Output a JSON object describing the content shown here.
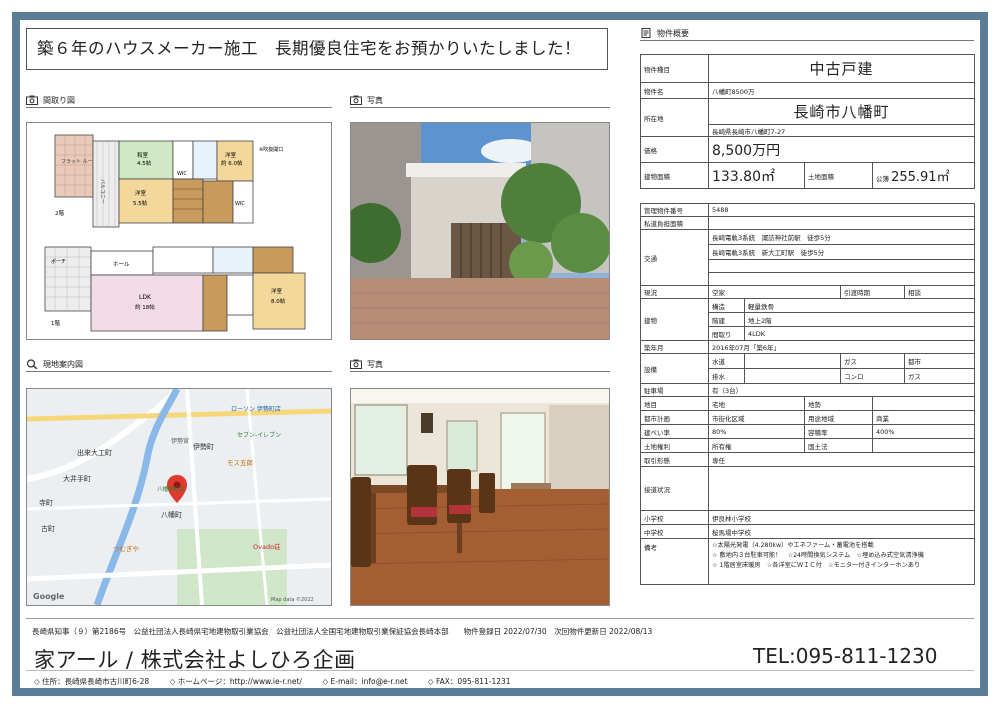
{
  "headline": "築６年のハウスメーカー施工　長期優良住宅をお預かりいたしました！",
  "sections": {
    "floorplan": "間取り図",
    "photo1": "写真",
    "map": "現地案内図",
    "photo2": "写真",
    "overview": "物件概要"
  },
  "floorplan_labels": {
    "balcony": "バルコニー",
    "floor2": "2階",
    "floor1": "1階",
    "ldk": "LDK",
    "ldk_size": "約 18帖",
    "room1": "洋室",
    "room1_size": "5.5帖",
    "room2": "洋室",
    "room2_size": "約 6.0帖",
    "room3": "洋室",
    "room3_size": "8.0帖",
    "washitsu": "和室",
    "washitsu_size": "4.5帖",
    "wic1": "WIC",
    "wic2": "WIC",
    "hall": "ホール",
    "porch": "ポーチ",
    "note": "※吹抜開口",
    "roof": "フラット ルーフ"
  },
  "map_labels": {
    "yahata": "八幡町",
    "ise": "伊勢町",
    "ise_shrine": "伊勢宮",
    "idekuwa": "出来大工町",
    "oisawa": "大井手町",
    "tera": "寺町",
    "furu": "古町",
    "lawson": "ローソン 伊勢町店",
    "seven": "セブン-イレブン",
    "mos": "モス五郎",
    "ovado": "Ovado荘",
    "tsumugiya": "つむぎや",
    "google": "Google",
    "mapdata": "Map data ©2022",
    "shrine": "八幡神社前"
  },
  "table1": {
    "kind_label": "物件種目",
    "kind_value": "中古戸建",
    "name_label": "物件名",
    "name_value": "八幡町8500万",
    "loc_label": "所在地",
    "loc_value_big": "長崎市八幡町",
    "loc_value_small": "長崎県長崎市八幡町7-27",
    "price_label": "価格",
    "price_value": "8,500万円",
    "bldg_area_label": "建物面積",
    "bldg_area_value": "133.80㎡",
    "land_area_label": "土地面積",
    "land_area_prefix": "公簿",
    "land_area_value": "255.91㎡"
  },
  "table2": {
    "mgmt_no_label": "管理物件番号",
    "mgmt_no_value": "5488",
    "private_road_label": "私道負担面積",
    "private_road_value": "",
    "traffic_label": "交通",
    "traffic_1": "長崎電軌3系統　諏訪神社前駅　徒歩5分",
    "traffic_2": "長崎電軌3系統　新大工町駅　徒歩5分",
    "status_label": "現況",
    "status_value": "空家",
    "handover_label": "引渡時期",
    "handover_value": "相談",
    "building_label": "建物",
    "structure_label": "構造",
    "structure_value": "軽量鉄骨",
    "floors_label": "階建",
    "floors_value": "地上2階",
    "layout_label": "間取り",
    "layout_value": "4LDK",
    "built_label": "築年月",
    "built_value": "2016年07月「築6年」",
    "facility_label": "設備",
    "water_label": "水道",
    "water_value": "",
    "gas_label": "ガス",
    "gas_value": "都市",
    "drain_label": "排水",
    "drain_value": "",
    "stove_label": "コンロ",
    "stove_value": "ガス",
    "parking_label": "駐車場",
    "parking_value": "有（3台）",
    "land_cat_label": "地目",
    "land_cat_value": "宅地",
    "terrain_label": "地勢",
    "terrain_value": "",
    "city_plan_label": "都市計画",
    "city_plan_value": "市街化区域",
    "use_zone_label": "用途地域",
    "use_zone_value": "商業",
    "coverage_label": "建ぺい率",
    "coverage_value": "80%",
    "far_label": "容積率",
    "far_value": "400%",
    "land_right_label": "土地権利",
    "land_right_value": "所有権",
    "land_law_label": "国土法",
    "land_law_value": "",
    "trade_label": "取引形態",
    "trade_value": "専任",
    "road_label": "接道状況",
    "road_value": "",
    "elem_label": "小学校",
    "elem_value": "伊良林小学校",
    "junior_label": "中学校",
    "junior_value": "桜馬場中学校",
    "remarks_label": "備考",
    "remarks_1": "☆太陽光発電（4.280kw）やエネファーム・蓄電池を搭載",
    "remarks_2": "☆ 敷地内３台駐車可能！　☆24時間換気システム　☆埋め込み式空気清浄機",
    "remarks_3": "☆ 1階居室床暖房　☆各洋室にＷＩＣ付　☆モニター付きインターホンあり"
  },
  "footer": {
    "registration": "長崎県知事（９）第2186号　公益社団法人長崎県宅地建物取引業協会　公益社団法人全国宅地建物取引業保証協会長崎本部　　物件登録日 2022/07/30　次回物件更新日 2022/08/13",
    "company": "家アール / 株式会社よしひろ企画",
    "tel": "TEL:095-811-1230",
    "address": "◇ 住所：長崎県長崎市古川町6-28",
    "homepage": "◇ ホームページ：http://www.ie-r.net/",
    "email": "◇ E-mail：info@e-r.net",
    "fax": "◇ FAX：095-811-1231"
  }
}
